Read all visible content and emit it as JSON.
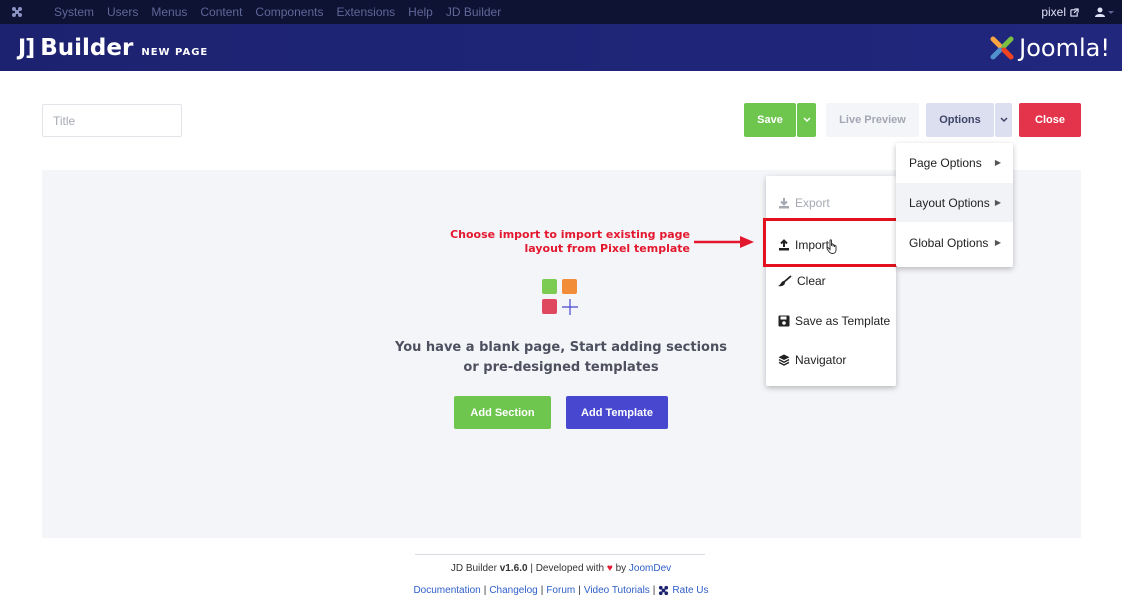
{
  "topbar": {
    "menu": [
      "System",
      "Users",
      "Menus",
      "Content",
      "Components",
      "Extensions",
      "Help",
      "JD Builder"
    ],
    "site_link": "pixel"
  },
  "header": {
    "brand_mark": "J]",
    "brand_word": "Builder",
    "page_label": "NEW PAGE",
    "joomla_text": "Joomla!"
  },
  "toolbar": {
    "title_placeholder": "Title",
    "save_label": "Save",
    "live_preview_label": "Live Preview",
    "options_label": "Options",
    "close_label": "Close"
  },
  "canvas": {
    "blank_line1": "You have a blank page, Start adding sections",
    "blank_line2": "or pre-designed templates",
    "add_section_label": "Add Section",
    "add_template_label": "Add Template",
    "icon_colors": [
      "#7ccb53",
      "#f28c38",
      "#e0485f",
      "#4748cf"
    ]
  },
  "annotation": {
    "line1": "Choose import to import existing page",
    "line2": "layout from Pixel template",
    "color": "#e3182f"
  },
  "layout_menu": {
    "export_label": "Export",
    "import_label": "Import",
    "clear_label": "Clear",
    "save_template_label": "Save as Template",
    "navigator_label": "Navigator"
  },
  "options_menu": {
    "page_options": "Page Options",
    "layout_options": "Layout Options",
    "global_options": "Global Options"
  },
  "footer": {
    "product": "JD Builder",
    "version": "v1.6.0",
    "dev_text": "| Developed with",
    "by_text": "by",
    "dev_name": "JoomDev",
    "links": [
      "Documentation",
      "Changelog",
      "Forum",
      "Video Tutorials"
    ],
    "rate_label": "Rate Us"
  },
  "colors": {
    "green": "#6ec64f",
    "purple": "#4748cf",
    "red": "#e3344c",
    "header": "#1d2270"
  }
}
